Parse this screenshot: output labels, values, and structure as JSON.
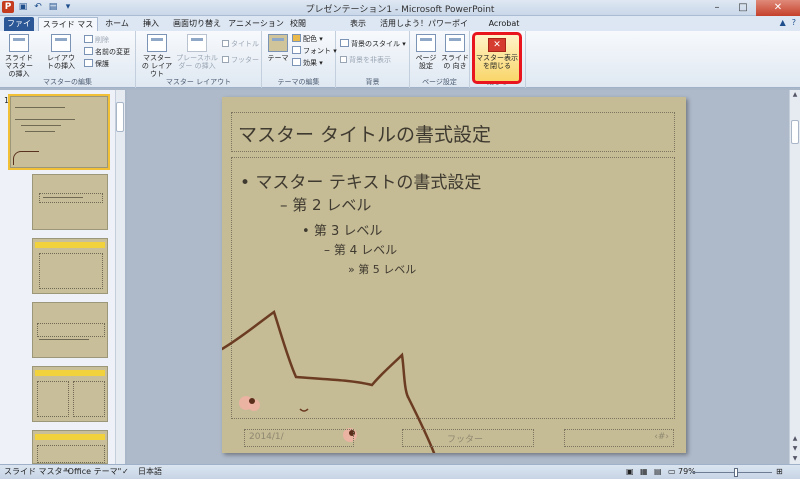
{
  "window": {
    "title": "プレゼンテーション1 - Microsoft PowerPoint",
    "app_icon": "powerpoint-icon",
    "qat": [
      "save-icon",
      "undo-icon",
      "redo-icon",
      "customize-icon"
    ]
  },
  "tabs": [
    {
      "label": "ファイル",
      "name": "file"
    },
    {
      "label": "スライド マスター",
      "name": "slide-master"
    },
    {
      "label": "ホーム",
      "name": "home"
    },
    {
      "label": "挿入",
      "name": "insert"
    },
    {
      "label": "画面切り替え",
      "name": "transitions"
    },
    {
      "label": "アニメーション",
      "name": "animations"
    },
    {
      "label": "校閲",
      "name": "review"
    },
    {
      "label": "表示",
      "name": "view"
    },
    {
      "label": "活用しよう！パワーポイント",
      "name": "katsuyou"
    },
    {
      "label": "Acrobat",
      "name": "acrobat"
    }
  ],
  "ribbon": {
    "group_master_edit": {
      "label": "マスターの編集",
      "insert_slide_master": "スライド マスターの挿入",
      "insert_layout": "レイアウトの挿入",
      "delete": "削除",
      "rename": "名前の変更",
      "preserve": "保護"
    },
    "group_master_layout": {
      "label": "マスター レイアウト",
      "master_layout": "マスターの レイアウト",
      "insert_placeholder": "プレースホルダー の挿入",
      "title": "タイトル",
      "footer": "フッター"
    },
    "group_theme": {
      "label": "テーマの編集",
      "themes": "テーマ",
      "colors": "配色",
      "fonts": "フォント",
      "effects": "効果"
    },
    "group_background": {
      "label": "背景",
      "background_styles": "背景のスタイル",
      "hide_background": "背景を非表示"
    },
    "group_page_setup": {
      "label": "ページ設定",
      "page_setup": "ページ 設定",
      "slide_orientation": "スライドの 向き"
    },
    "group_close": {
      "label": "閉じる",
      "close_master": "マスター表示 を閉じる"
    }
  },
  "thumbnails": {
    "first_number": "1"
  },
  "slide": {
    "title": "マスター タイトルの書式設定",
    "level1": "マスター テキストの書式設定",
    "level2": "第 2 レベル",
    "level3": "第 3 レベル",
    "level4": "第 4 レベル",
    "level5": "第 5 レベル",
    "date": "2014/1/",
    "footer": "フッター",
    "page_number": "‹#›",
    "background_color": "#c5bb95"
  },
  "status": {
    "view": "スライド マスター",
    "theme": "\"Office テーマ\"",
    "language": "日本語",
    "zoom": "79%"
  }
}
